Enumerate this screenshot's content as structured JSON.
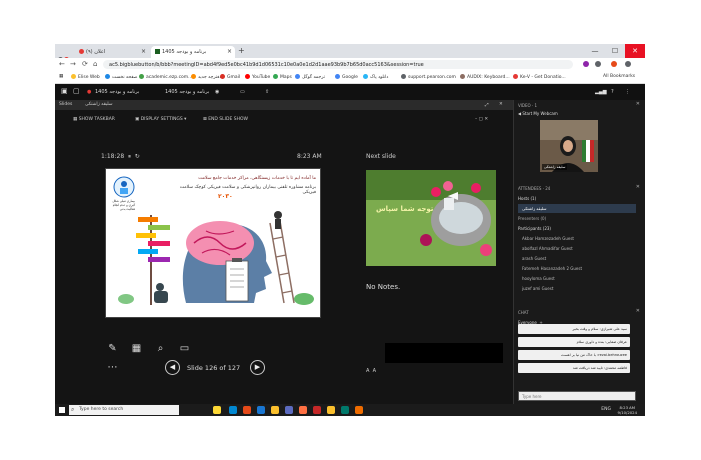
{
  "browser": {
    "tabs": [
      {
        "label": "(۹) اعلان"
      },
      {
        "label": "برنامه و بودجه 1405"
      }
    ],
    "url": "ac5.bigbluebutton/b/bbb?meetingID=abd4f9ed5e0bc41b9d1d06531c10e0a0e1d2d1aae93b9b7b65d0acc5163&session=true",
    "bookmarks": [
      "Elise Web",
      "صفحه نخست",
      "academic.ezp.com...",
      "دفترچه جدید",
      "Gmail",
      "YouTube",
      "Maps",
      "ترجمه گوگل",
      "Google",
      "دانلود پاک",
      "support.pearson.com",
      "AUDIX: Keyboard...",
      "Ke-V - Get Donatio..."
    ],
    "all_bookmarks": "All Bookmarks"
  },
  "meeting": {
    "title": "برنامه و بودجه 1405",
    "presentation_header": "Slides",
    "presenter_name": "سلیقه زاشتکی"
  },
  "presenter_view": {
    "toolbar": {
      "show_taskbar": "SHOW TASKBAR",
      "display_settings": "DISPLAY SETTINGS ▾",
      "end_show": "END SLIDE SHOW"
    },
    "timer": "1:18:28",
    "clock": "8:23 AM",
    "next_slide_label": "Next slide",
    "notes": "No Notes.",
    "slide_counter": "Slide 126 of 127",
    "current_slide": {
      "heading": "ما آماده ایم تا با خدمات زیستگاهی، مراکز خدمات جامع سلامت",
      "subheading": "برنامه مشاوره تلفنی بیماران روانپزشکی و سلامت فیزیکی کوچک سلامت فیزیکی",
      "years": "۲۰۳۰",
      "list_text": "بیماری تنبلی شکل گیری و عدم انجام فعالیت بدنی"
    },
    "next_slide": {
      "caption": "توجه شما سپاس"
    }
  },
  "right_panel": {
    "webcams_header": "VIDEO · 1",
    "start_webcam": "Start My Webcam",
    "attendees_header": "ATTENDEES · 24",
    "hosts_label": "Hosts (1)",
    "host_name": "سلیقه زاشتکی",
    "presenters_label": "Presenters (0)",
    "participants_label": "Participants (23)",
    "participants": [
      {
        "name": "Akbar Hamzezadeh",
        "role": "Guest"
      },
      {
        "name": "abolfazl Ahmadifar",
        "role": "Guest"
      },
      {
        "name": "arash",
        "role": "Guest"
      },
      {
        "name": "Fatemeh Hasanzadeh 2",
        "role": "Guest"
      },
      {
        "name": "hooyloma",
        "role": "Guest"
      },
      {
        "name": "juzef ami",
        "role": "Guest"
      }
    ],
    "chat_header": "CHAT",
    "chat_tab": "Everyone",
    "chat_messages": [
      "سید علی شیرازی: سلام و وقت بخیر",
      "عرفان صفایی: بنده و داوری سلام",
      "rezai.behrouzee: با خاک من نیا بر اهست",
      "فاطمه محمدی: تایید شد دریافت شد"
    ],
    "chat_placeholder": "Type here"
  },
  "taskbar": {
    "search_placeholder": "Type here to search",
    "language": "ENG",
    "time": "8:23 AM",
    "date": "9/10/2024"
  },
  "colors": {
    "accent": "#e53935",
    "dark_bg": "#1f1f1f",
    "panel_highlight": "#2d3b4d"
  }
}
